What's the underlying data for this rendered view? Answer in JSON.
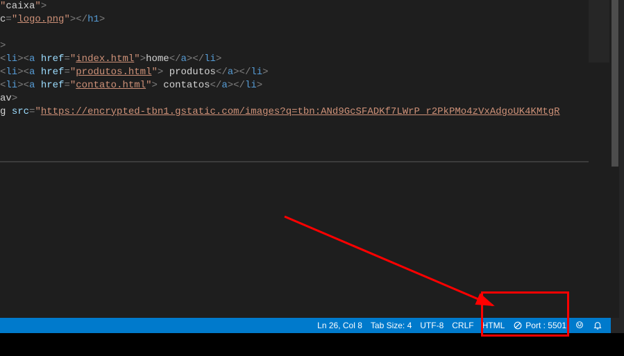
{
  "code": {
    "gt": ">",
    "l1": "caixa",
    "l2v": "logo.png",
    "l5v": "index.html",
    "l5t": "home",
    "l6v": "produtos.html",
    "l6t": " produtos",
    "l7v": "contato.html",
    "l7t": " contatos",
    "l9v": "https://encrypted-tbn1.gstatic.com/images?q=tbn:ANd9GcSFADKf7LWrP_r2PkPMo4zVxAdgoUK4KMtgR"
  },
  "status": {
    "cursor": "Ln 26, Col 8",
    "tabsize": "Tab Size: 4",
    "encoding": "UTF-8",
    "eol": "CRLF",
    "lang": "HTML",
    "port": "Port : 5501"
  },
  "colors": {
    "statusbar": "#007acc",
    "editor_bg": "#1e1e1e",
    "annotation": "#ff0000"
  }
}
